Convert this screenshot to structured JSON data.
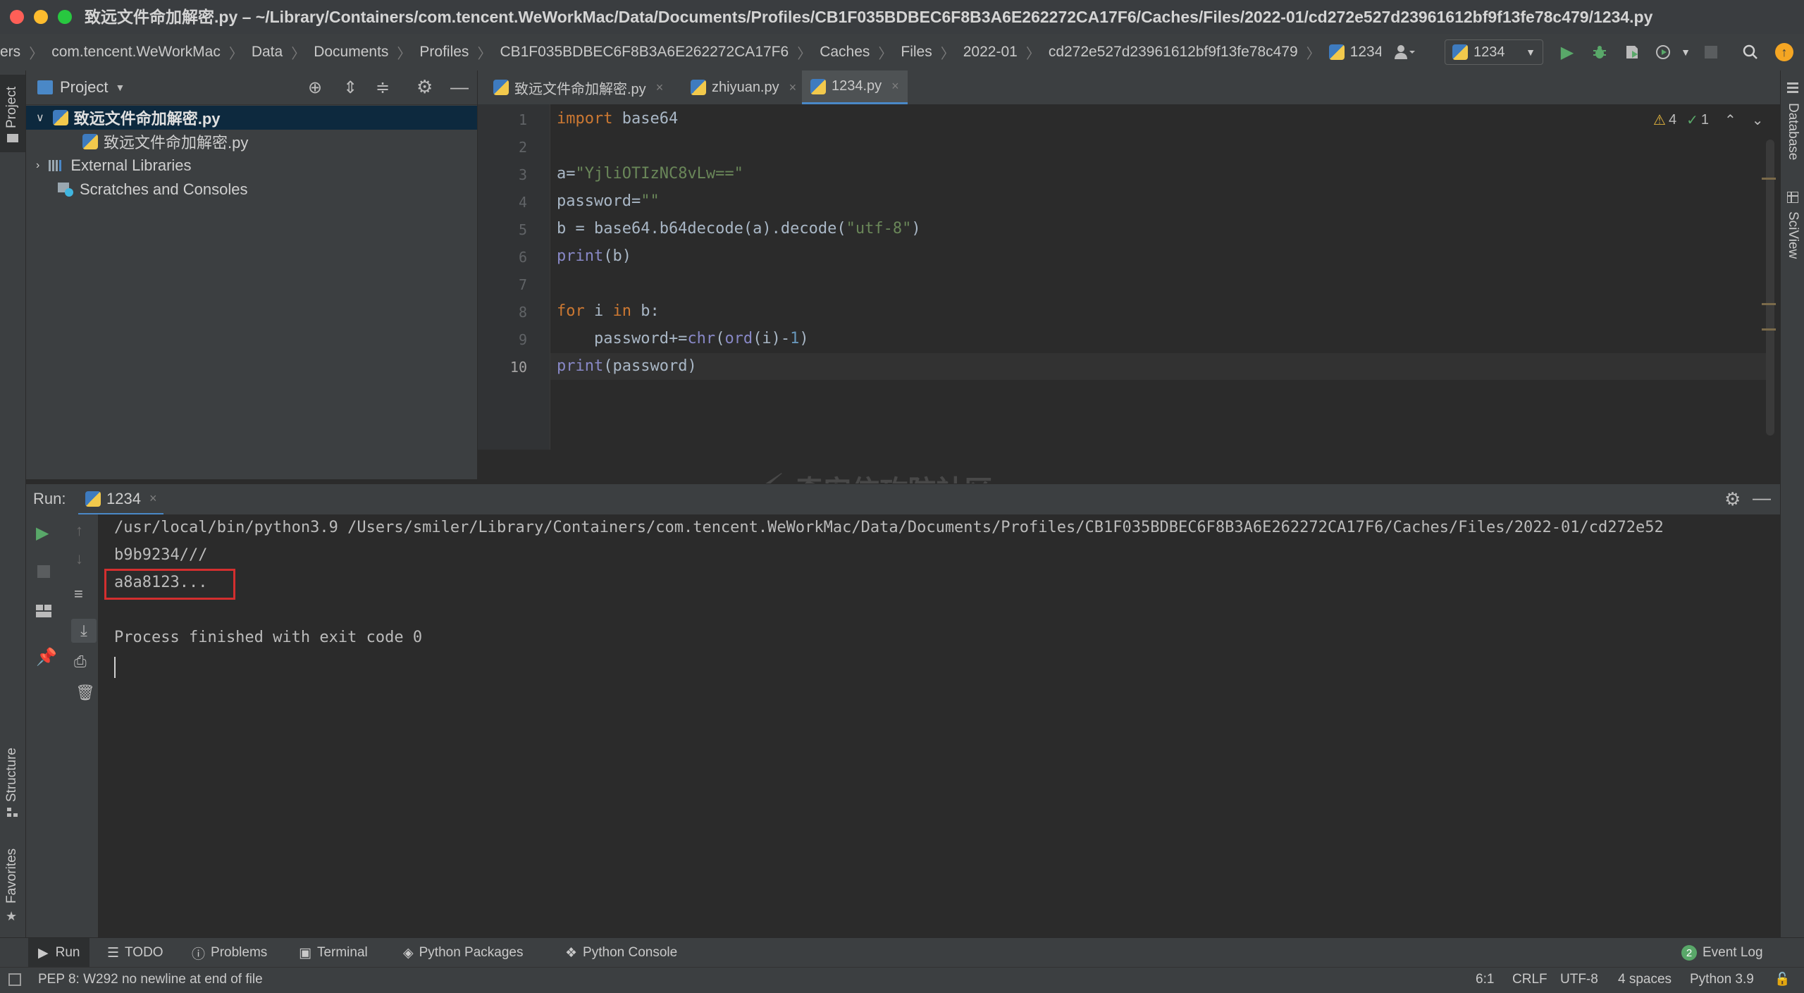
{
  "window": {
    "title": "致远文件命加解密.py – ~/Library/Containers/com.tencent.WeWorkMac/Data/Documents/Profiles/CB1F035BDBEC6F8B3A6E262272CA17F6/Caches/Files/2022-01/cd272e527d23961612bf9f13fe78c479/1234.py"
  },
  "breadcrumbs": [
    "ers",
    "com.tencent.WeWorkMac",
    "Data",
    "Documents",
    "Profiles",
    "CB1F035BDBEC6F8B3A6E262272CA17F6",
    "Caches",
    "Files",
    "2022-01",
    "cd272e527d23961612bf9f13fe78c479",
    "1234.py"
  ],
  "run_config": {
    "name": "1234"
  },
  "left_stripe": {
    "project": "Project",
    "structure": "Structure",
    "favorites": "Favorites"
  },
  "right_stripe": {
    "database": "Database",
    "sciview": "SciView"
  },
  "project_panel": {
    "title": "Project",
    "items": [
      {
        "label": "致远文件命加解密.py"
      },
      {
        "label": "致远文件命加解密.py"
      },
      {
        "label": "External Libraries"
      },
      {
        "label": "Scratches and Consoles"
      }
    ]
  },
  "editor": {
    "tabs": [
      {
        "label": "致远文件命加解密.py"
      },
      {
        "label": "zhiyuan.py"
      },
      {
        "label": "1234.py"
      }
    ],
    "line_numbers": [
      "1",
      "2",
      "3",
      "4",
      "5",
      "6",
      "7",
      "8",
      "9",
      "10"
    ],
    "inspection": {
      "warnings": "4",
      "ok": "1"
    },
    "code": {
      "l1_kw": "import",
      "l1_rest": " base64",
      "l3_a": "a=",
      "l3_str": "\"YjliOTIzNC8vLw==\"",
      "l4_a": "password=",
      "l4_str": "\"\"",
      "l5_a": "b = base64.b64decode(a).decode(",
      "l5_str": "\"utf-8\"",
      "l5_b": ")",
      "l6_bi": "print",
      "l6_rest": "(b)",
      "l8_kw1": "for",
      "l8_mid": " i ",
      "l8_kw2": "in",
      "l8_rest": " b:",
      "l9_a": "    password+=",
      "l9_bi1": "chr",
      "l9_b": "(",
      "l9_bi2": "ord",
      "l9_c": "(i)-",
      "l9_num": "1",
      "l9_d": ")",
      "l10_bi": "print",
      "l10_rest": "(password)"
    }
  },
  "run_panel": {
    "label": "Run:",
    "tab": "1234",
    "output": [
      "/usr/local/bin/python3.9 /Users/smiler/Library/Containers/com.tencent.WeWorkMac/Data/Documents/Profiles/CB1F035BDBEC6F8B3A6E262272CA17F6/Caches/Files/2022-01/cd272e52",
      "b9b9234///",
      "a8a8123...",
      "",
      "Process finished with exit code 0"
    ]
  },
  "bottom_tools": [
    "Run",
    "TODO",
    "Problems",
    "Terminal",
    "Python Packages",
    "Python Console"
  ],
  "event_log": {
    "count": "2",
    "label": "Event Log"
  },
  "status": {
    "message": "PEP 8: W292 no newline at end of file",
    "position": "6:1",
    "line_sep": "CRLF",
    "encoding": "UTF-8",
    "indent": "4 spaces",
    "interpreter": "Python 3.9"
  },
  "watermark": "奇安信攻防社区",
  "colors": {
    "highlight_box": "#d32f2f",
    "accent_blue": "#4a88c7",
    "run_green": "#59a869"
  }
}
